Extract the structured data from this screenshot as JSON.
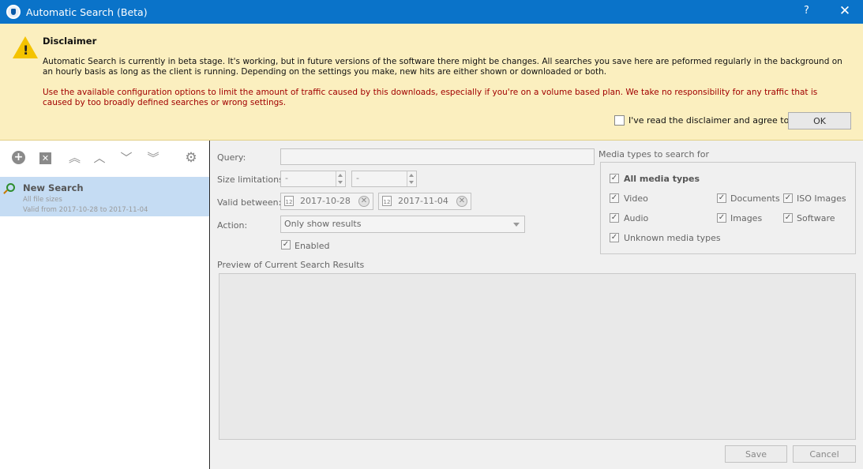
{
  "window": {
    "title": "Automatic Search (Beta)",
    "help_label": "?",
    "close_label": "✕"
  },
  "disclaimer": {
    "title": "Disclaimer",
    "text": "Automatic Search is currently in beta stage. It's working, but in future versions of the software there might be changes. All searches you save here are peformed regularly in the background on an hourly basis as long as the client is running. Depending on the settings you make, new hits are either shown or downloaded or both.",
    "warning": "Use the available configuration options to limit the amount of traffic caused by this downloads, especially if you're on a volume based plan. We take no responsibility for any traffic that is caused by too broadly defined searches or wrong settings.",
    "agree_label": "I've read the disclaimer and agree to it.",
    "agree_checked": false,
    "ok_label": "OK",
    "warning_color": "#a10000"
  },
  "toolbar": {
    "icons": [
      "add-icon",
      "delete-icon",
      "move-top-icon",
      "move-up-icon",
      "move-down-icon",
      "move-bottom-icon",
      "gear-icon"
    ]
  },
  "searches": [
    {
      "name": "New Search",
      "sizes": "All file sizes",
      "valid": "Valid from 2017-10-28 to 2017-11-04",
      "selected": true
    }
  ],
  "form": {
    "query_label": "Query:",
    "query_value": "",
    "size_label": "Size limitations:",
    "size_min": "-",
    "size_max": "-",
    "valid_label": "Valid between:",
    "valid_from": "2017-10-28",
    "valid_to": "2017-11-04",
    "calendar_glyph": "12",
    "clear_glyph": "✕",
    "action_label": "Action:",
    "action_value": "Only show results",
    "enabled_label": "Enabled",
    "enabled_checked": true
  },
  "media": {
    "group_label": "Media types to search for",
    "all_label": "All media types",
    "types": [
      {
        "label": "Video",
        "checked": true
      },
      {
        "label": "Documents",
        "checked": true
      },
      {
        "label": "ISO Images",
        "checked": true
      },
      {
        "label": "Audio",
        "checked": true
      },
      {
        "label": "Images",
        "checked": true
      },
      {
        "label": "Software",
        "checked": true
      },
      {
        "label": "Unknown media types",
        "checked": true
      }
    ]
  },
  "preview": {
    "label": "Preview of Current Search Results"
  },
  "buttons": {
    "save_label": "Save",
    "cancel_label": "Cancel"
  }
}
